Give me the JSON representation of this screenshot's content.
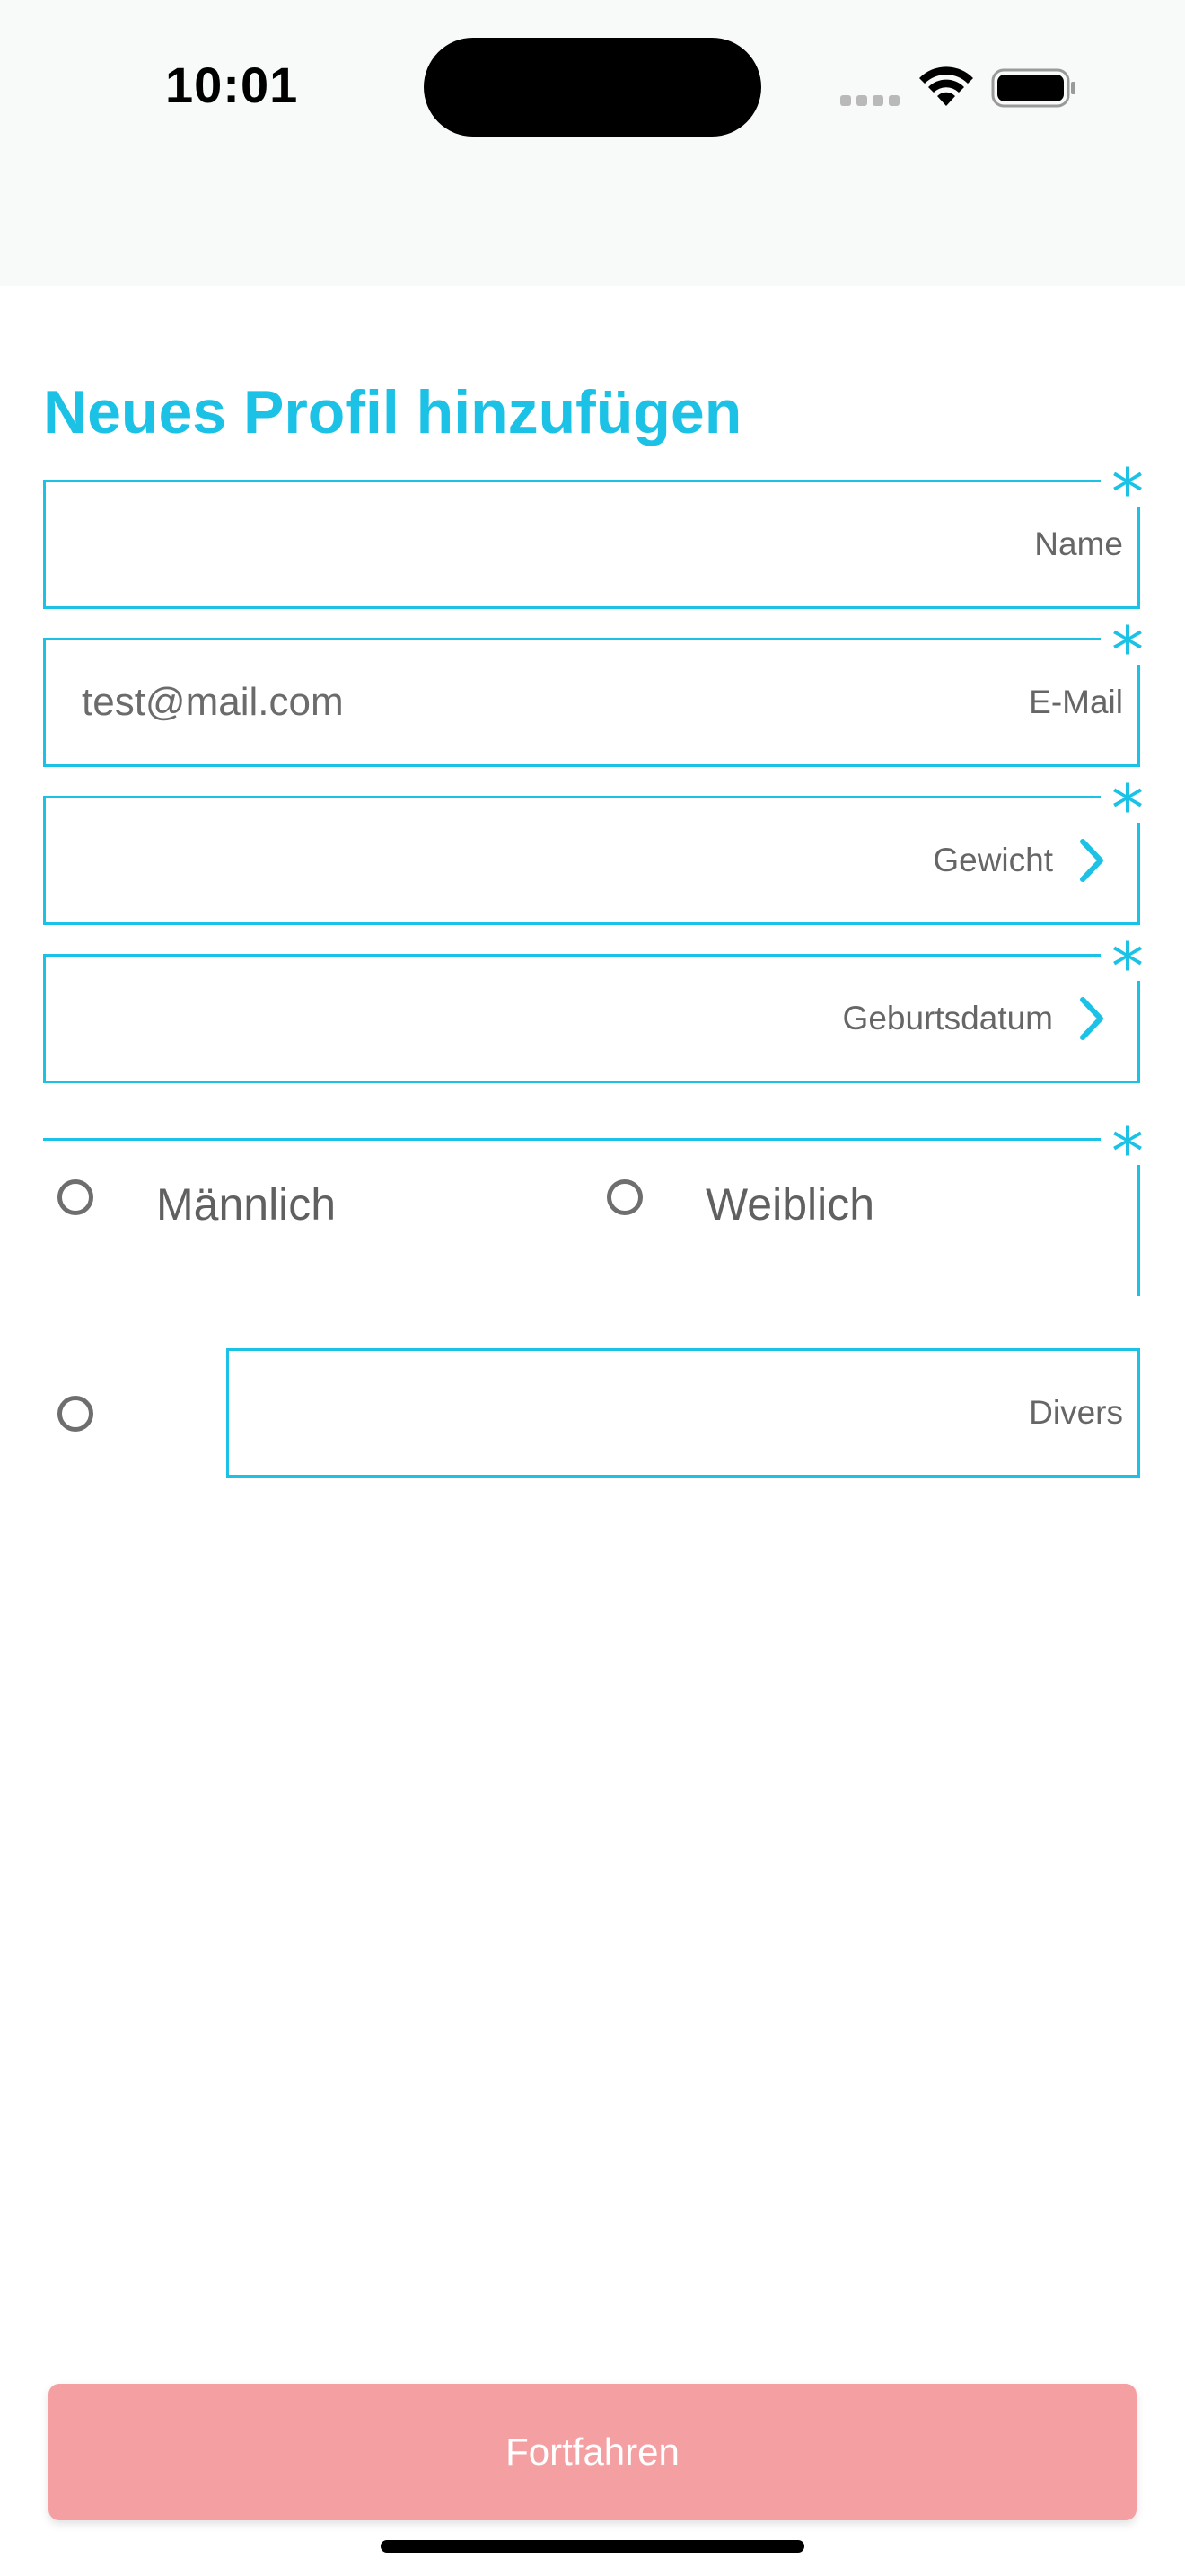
{
  "status_bar": {
    "time": "10:01"
  },
  "header": {
    "title": "Neues Profil hinzufügen"
  },
  "form": {
    "required_marker": "*",
    "name": {
      "label": "Name",
      "value": ""
    },
    "email": {
      "label": "E-Mail",
      "value": "test@mail.com"
    },
    "weight": {
      "label": "Gewicht",
      "value": ""
    },
    "birthdate": {
      "label": "Geburtsdatum",
      "value": ""
    },
    "gender": {
      "options": [
        "Männlich",
        "Weiblich"
      ],
      "other_label": "Divers",
      "other_value": ""
    }
  },
  "footer": {
    "continue_label": "Fortfahren"
  },
  "colors": {
    "accent": "#1cc2e6",
    "button_disabled": "#f4a0a3",
    "label_gray": "#666666"
  }
}
